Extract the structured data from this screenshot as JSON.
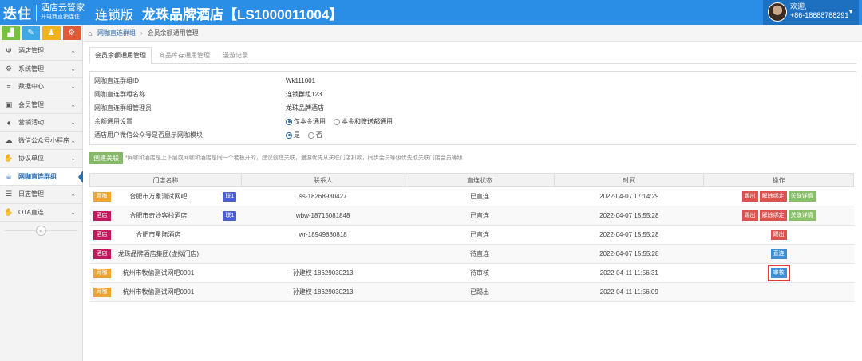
{
  "header": {
    "logo_mark": "迭住",
    "logo_line1": "酒店云管家",
    "logo_line2": "开电商直销连住",
    "edition": "连锁版",
    "hotel_title": "龙珠品牌酒店【LS1000011004】",
    "user_greeting": "欢迎,",
    "user_phone": "+86-18688788291",
    "caret_icon": "caret-down-icon"
  },
  "quick_buttons": [
    {
      "icon": "chart-icon",
      "glyph": "▟",
      "color": "#78c043"
    },
    {
      "icon": "pencil-icon",
      "glyph": "✎",
      "color": "#3fa9e8"
    },
    {
      "icon": "group-icon",
      "glyph": "♟",
      "color": "#f1b31c"
    },
    {
      "icon": "gears-icon",
      "glyph": "⚙",
      "color": "#e05a3a"
    }
  ],
  "sidebar": {
    "items": [
      {
        "label": "酒店管理",
        "icon": "fork-knife-icon",
        "glyph": "Ψ"
      },
      {
        "label": "系统管理",
        "icon": "gear-icon",
        "glyph": "⚙"
      },
      {
        "label": "数据中心",
        "icon": "database-icon",
        "glyph": "≡"
      },
      {
        "label": "会员管理",
        "icon": "member-card-icon",
        "glyph": "▣"
      },
      {
        "label": "营销活动",
        "icon": "gift-icon",
        "glyph": "♦"
      },
      {
        "label": "微信公众号小程序",
        "icon": "cloud-icon",
        "glyph": "☁"
      },
      {
        "label": "协议单位",
        "icon": "handshake-icon",
        "glyph": "✋"
      },
      {
        "label": "网咖直连群组",
        "icon": "coffee-cup-icon",
        "glyph": "☕",
        "active": true
      },
      {
        "label": "日志管理",
        "icon": "list-icon",
        "glyph": "☰"
      },
      {
        "label": "OTA直连",
        "icon": "handshake-icon",
        "glyph": "✋"
      }
    ],
    "collapse_icon": "double-chevron-left-icon",
    "collapse_glyph": "«"
  },
  "breadcrumb": {
    "home_icon": "home-icon",
    "home_glyph": "⌂",
    "items": [
      "网咖直连群组",
      "会员余额通用管理"
    ]
  },
  "tabs": [
    "会员余额通用管理",
    "商品库存通用管理",
    "漫游记录"
  ],
  "info": {
    "rows": [
      {
        "label": "网咖直连群组ID",
        "value": "Wk111001"
      },
      {
        "label": "网咖直连群组名称",
        "value": "连锁群组123"
      },
      {
        "label": "网咖直连群组管理员",
        "value": "龙珠品牌酒店"
      }
    ],
    "balance_setting_label": "余额通用设置",
    "balance_options": [
      {
        "label": "仅本金通用",
        "checked": true
      },
      {
        "label": "本金和赠送都通用",
        "checked": false
      }
    ],
    "wechat_label": "酒店用户微信公众号是否显示网咖模块",
    "wechat_options": [
      {
        "label": "是",
        "checked": true
      },
      {
        "label": "否",
        "checked": false
      }
    ]
  },
  "actions": {
    "create_label": "创建关联",
    "hint": "*网咖和酒店是上下层或网咖和酒店是同一个老板开的，建议创建关联，漫游优先从关联门店扣款，同步会员等级优先取关联门店会员等级"
  },
  "table": {
    "columns": [
      "门店名称",
      "联系人",
      "直连状态",
      "时间",
      "操作"
    ],
    "rows": [
      {
        "type": "网咖",
        "name": "合肥市万象测试网吧",
        "linked": "联1",
        "contact": "ss-18268930427",
        "status": "已直连",
        "time": "2022-04-07 17:14:29",
        "ops": [
          {
            "label": "踢出",
            "color": "#d9534f"
          },
          {
            "label": "解除绑定",
            "color": "#d9534f"
          },
          {
            "label": "关联详情",
            "color": "#8bc06a"
          }
        ]
      },
      {
        "type": "酒店",
        "name": "合肥市奇妙客栈酒店",
        "linked": "联1",
        "contact": "wbw-18715081848",
        "status": "已直连",
        "time": "2022-04-07 15:55:28",
        "ops": [
          {
            "label": "踢出",
            "color": "#d9534f"
          },
          {
            "label": "解除绑定",
            "color": "#d9534f"
          },
          {
            "label": "关联详情",
            "color": "#8bc06a"
          }
        ]
      },
      {
        "type": "酒店",
        "name": "合肥市星际酒店",
        "linked": "",
        "contact": "wr-18949880818",
        "status": "已直连",
        "time": "2022-04-07 15:55:28",
        "ops": [
          {
            "label": "踢出",
            "color": "#d9534f"
          }
        ]
      },
      {
        "type": "酒店",
        "name": "龙珠品牌酒店集团(虚拟门店)",
        "linked": "",
        "contact": "",
        "status": "待直连",
        "time": "2022-04-07 15:55:28",
        "ops": [
          {
            "label": "直连",
            "color": "#3d8ed8"
          }
        ]
      },
      {
        "type": "网咖",
        "name": "杭州市牧偷测试网吧0901",
        "linked": "",
        "contact": "孙建权-18629030213",
        "status": "待审核",
        "time": "2022-04-11 11:56:31",
        "ops": [
          {
            "label": "审核",
            "color": "#3d8ed8",
            "highlight": true
          }
        ]
      },
      {
        "type": "网咖",
        "name": "杭州市牧偷测试网吧0901",
        "linked": "",
        "contact": "孙建权-18629030213",
        "status": "已踢出",
        "time": "2022-04-11 11:56:09",
        "ops": []
      }
    ]
  },
  "colors": {
    "topbar": "#2b8ee6",
    "badge_netcafe": "#f0a431",
    "badge_hotel": "#c0195e",
    "highlight_box": "#e53935"
  }
}
